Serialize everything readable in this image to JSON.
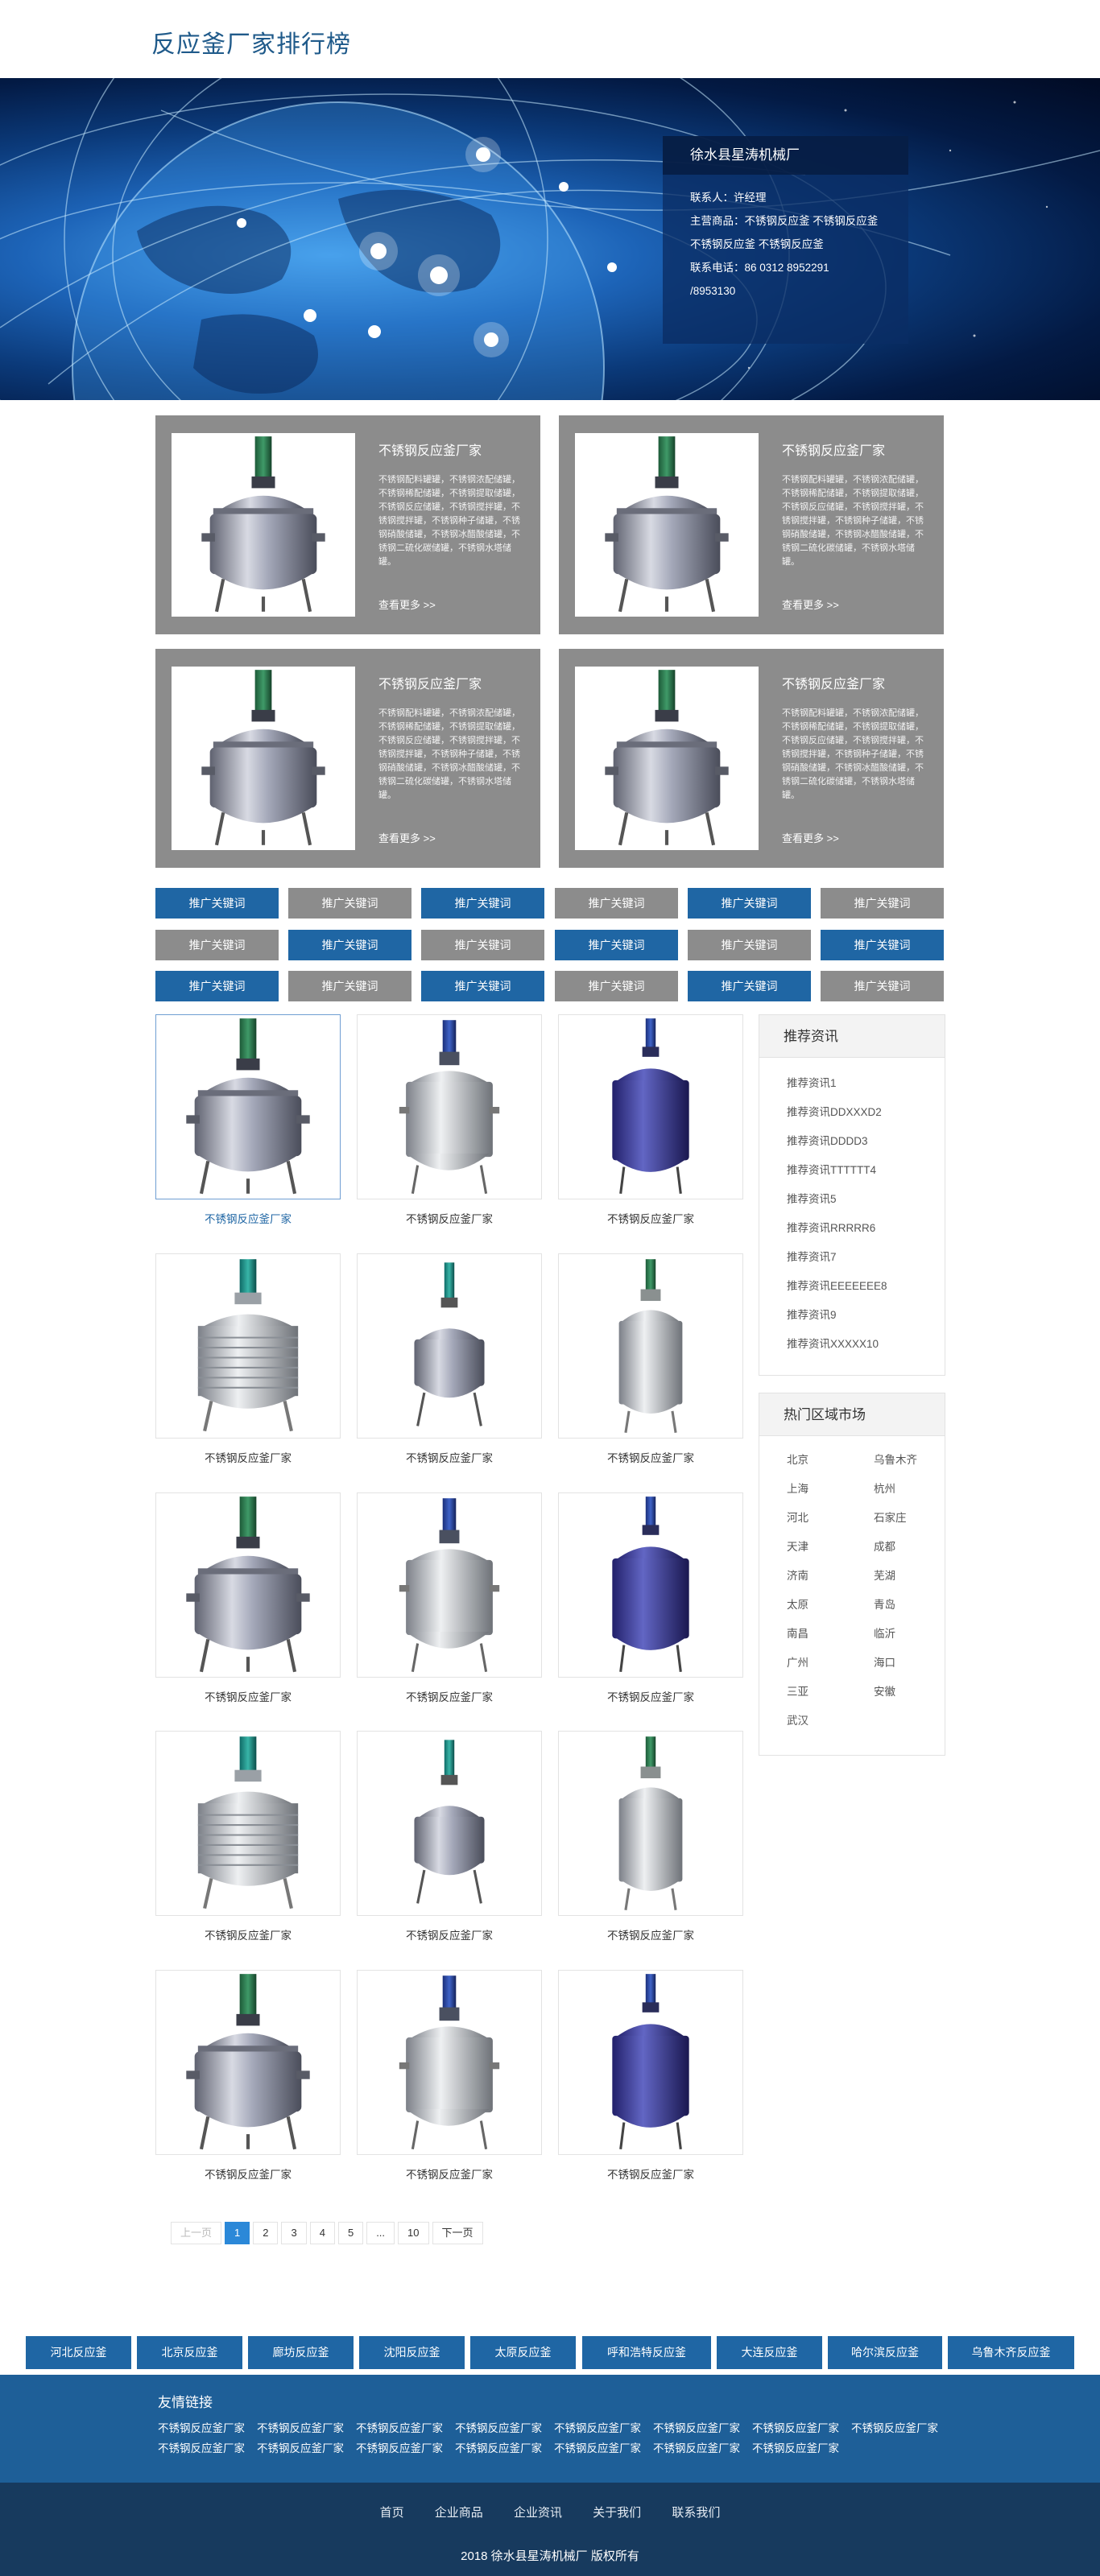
{
  "header": {
    "title": "反应釜厂家排行榜"
  },
  "contact": {
    "title": "徐水县星涛机械厂",
    "lines": [
      "联系人：许经理",
      "主营商品：不锈钢反应釜 不锈钢反应釜",
      "不锈钢反应釜 不锈钢反应釜",
      "联系电话：86 0312 8952291",
      "/8953130"
    ]
  },
  "featured": [
    {
      "title": "不锈钢反应釜厂家",
      "desc": "不锈钢配料罐罐，不锈钢浓配储罐，不锈钢稀配储罐，不锈钢提取储罐，不锈钢反应储罐，不锈钢搅拌罐，不锈钢搅拌罐，不锈钢种子储罐，不锈钢硝酸储罐，不锈钢冰醋酸储罐，不锈钢二硫化碳储罐，不锈钢水塔储罐。",
      "more": "查看更多 >>"
    },
    {
      "title": "不锈钢反应釜厂家",
      "desc": "不锈钢配料罐罐，不锈钢浓配储罐，不锈钢稀配储罐，不锈钢提取储罐，不锈钢反应储罐，不锈钢搅拌罐，不锈钢搅拌罐，不锈钢种子储罐，不锈钢硝酸储罐，不锈钢冰醋酸储罐，不锈钢二硫化碳储罐，不锈钢水塔储罐。",
      "more": "查看更多 >>"
    },
    {
      "title": "不锈钢反应釜厂家",
      "desc": "不锈钢配料罐罐，不锈钢浓配储罐，不锈钢稀配储罐，不锈钢提取储罐，不锈钢反应储罐，不锈钢搅拌罐，不锈钢搅拌罐，不锈钢种子储罐，不锈钢硝酸储罐，不锈钢冰醋酸储罐，不锈钢二硫化碳储罐，不锈钢水塔储罐。",
      "more": "查看更多 >>"
    },
    {
      "title": "不锈钢反应釜厂家",
      "desc": "不锈钢配料罐罐，不锈钢浓配储罐，不锈钢稀配储罐，不锈钢提取储罐，不锈钢反应储罐，不锈钢搅拌罐，不锈钢搅拌罐，不锈钢种子储罐，不锈钢硝酸储罐，不锈钢冰醋酸储罐，不锈钢二硫化碳储罐，不锈钢水塔储罐。",
      "more": "查看更多 >>"
    }
  ],
  "keywords": [
    "推广关键词",
    "推广关键词",
    "推广关键词",
    "推广关键词",
    "推广关键词",
    "推广关键词",
    "推广关键词",
    "推广关键词",
    "推广关键词",
    "推广关键词",
    "推广关键词",
    "推广关键词",
    "推广关键词",
    "推广关键词",
    "推广关键词",
    "推广关键词",
    "推广关键词",
    "推广关键词"
  ],
  "products": [
    "不锈钢反应釜厂家",
    "不锈钢反应釜厂家",
    "不锈钢反应釜厂家",
    "不锈钢反应釜厂家",
    "不锈钢反应釜厂家",
    "不锈钢反应釜厂家",
    "不锈钢反应釜厂家",
    "不锈钢反应釜厂家",
    "不锈钢反应釜厂家",
    "不锈钢反应釜厂家",
    "不锈钢反应釜厂家",
    "不锈钢反应釜厂家",
    "不锈钢反应釜厂家",
    "不锈钢反应釜厂家",
    "不锈钢反应釜厂家"
  ],
  "news": {
    "title": "推荐资讯",
    "items": [
      "推荐资讯1",
      "推荐资讯DDXXXD2",
      "推荐资讯DDDD3",
      "推荐资讯TTTTTT4",
      "推荐资讯5",
      "推荐资讯RRRRR6",
      "推荐资讯7",
      "推荐资讯EEEEEEE8",
      "推荐资讯9",
      "推荐资讯XXXXX10"
    ]
  },
  "regions": {
    "title": "热门区域市场",
    "cities": [
      "北京",
      "乌鲁木齐",
      "上海",
      "杭州",
      "河北",
      "石家庄",
      "天津",
      "成都",
      "济南",
      "芜湖",
      "太原",
      "青岛",
      "南昌",
      "临沂",
      "广州",
      "海口",
      "三亚",
      "安徽",
      "武汉"
    ]
  },
  "pagination": {
    "prev": "上一页",
    "pages": [
      "1",
      "2",
      "3",
      "4",
      "5",
      "...",
      "10"
    ],
    "next": "下一页",
    "current": "1"
  },
  "region_strip": [
    "河北反应釜",
    "北京反应釜",
    "廊坊反应釜",
    "沈阳反应釜",
    "太原反应釜",
    "呼和浩特反应釜",
    "大连反应釜",
    "哈尔滨反应釜",
    "乌鲁木齐反应釜"
  ],
  "friend_links": {
    "title": "友情链接",
    "items": [
      "不锈钢反应釜厂家",
      "不锈钢反应釜厂家",
      "不锈钢反应釜厂家",
      "不锈钢反应釜厂家",
      "不锈钢反应釜厂家",
      "不锈钢反应釜厂家",
      "不锈钢反应釜厂家",
      "不锈钢反应釜厂家",
      "不锈钢反应釜厂家",
      "不锈钢反应釜厂家",
      "不锈钢反应釜厂家",
      "不锈钢反应釜厂家",
      "不锈钢反应釜厂家",
      "不锈钢反应釜厂家",
      "不锈钢反应釜厂家"
    ]
  },
  "footer": {
    "nav": [
      "首页",
      "企业商品",
      "企业资讯",
      "关于我们",
      "联系我们"
    ],
    "copyright": "2018 徐水县星涛机械厂 版权所有"
  },
  "colors": {
    "brand_blue": "#1f66a4",
    "gray_card": "#8c8c8c",
    "footer": "#173a5e",
    "friend_bg": "#1e5f98",
    "page_active": "#2b88d8"
  }
}
